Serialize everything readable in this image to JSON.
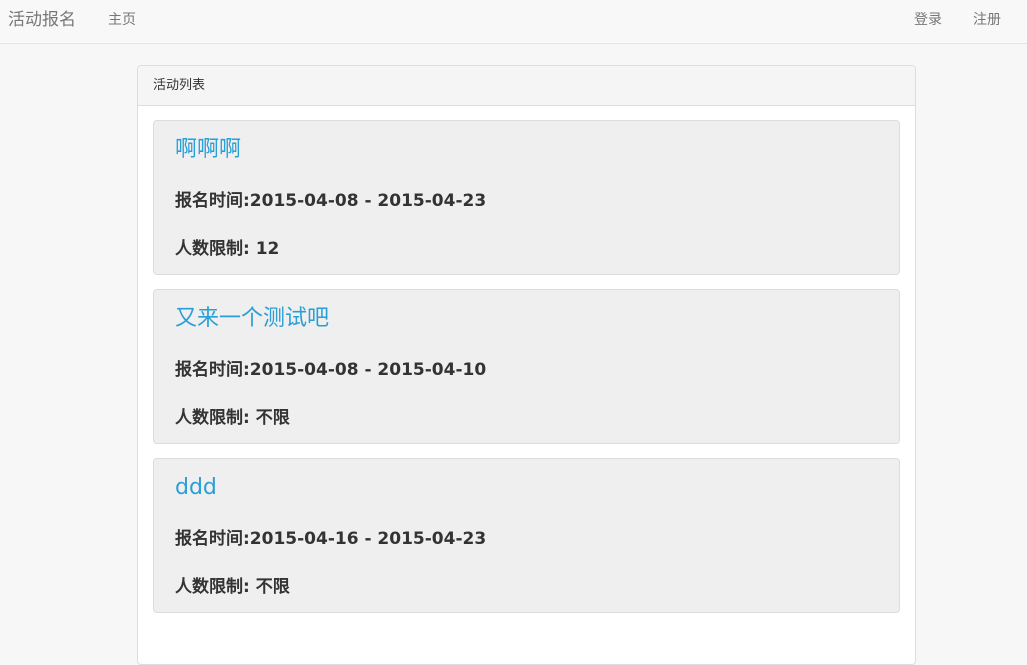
{
  "navbar": {
    "brand": "活动报名",
    "home": "主页",
    "login": "登录",
    "register": "注册"
  },
  "panel": {
    "heading": "活动列表",
    "activities": [
      {
        "title": "啊啊啊",
        "time": "报名时间:2015-04-08 - 2015-04-23",
        "limit": "人数限制: 12"
      },
      {
        "title": "又来一个测试吧",
        "time": "报名时间:2015-04-08 - 2015-04-10",
        "limit": "人数限制: 不限"
      },
      {
        "title": "ddd",
        "time": "报名时间:2015-04-16 - 2015-04-23",
        "limit": "人数限制: 不限"
      }
    ]
  },
  "colors": {
    "link": "#2a9fd6",
    "navbar_bg": "#f8f8f8",
    "well_bg": "#efefef"
  }
}
